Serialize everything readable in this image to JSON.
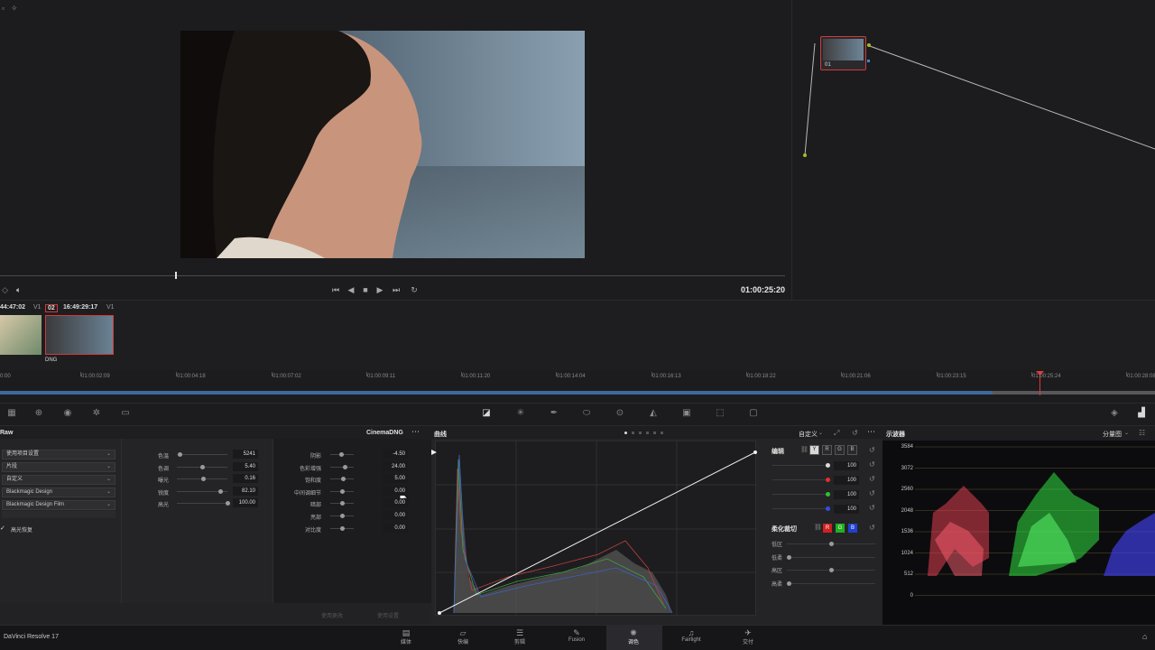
{
  "viewer": {
    "timecode": "01:00:25:20"
  },
  "nodes": {
    "node_label": "01"
  },
  "clips": {
    "clip1_tc": "44:47:02",
    "clip1_track": "V1",
    "clip2_num": "02",
    "clip2_tc": "16:49:29:17",
    "clip2_track": "V1",
    "clip2_name": "DNG"
  },
  "ruler": {
    "ticks": [
      "0:00",
      "01:00:02:09",
      "01:00:04:18",
      "01:00:07:02",
      "01:00:09:11",
      "01:00:11:20",
      "01:00:14:04",
      "01:00:16:13",
      "01:00:18:22",
      "01:00:21:06",
      "01:00:23:15",
      "01:00:25:24",
      "01:00:28:08"
    ]
  },
  "raw": {
    "title": "Raw",
    "codec": "CinemaDNG",
    "selects": [
      "使用项目设置",
      "片段",
      "自定义",
      "Blackmagic Design",
      "Blackmagic Design Film"
    ],
    "checkbox_label": "高光恢复",
    "col1": [
      {
        "label": "色温",
        "value": "5241",
        "pos": 0.05
      },
      {
        "label": "色调",
        "value": "5.40",
        "pos": 0.5
      },
      {
        "label": "曝光",
        "value": "0.16",
        "pos": 0.52
      },
      {
        "label": "锐度",
        "value": "82.10",
        "pos": 0.85
      },
      {
        "label": "高光",
        "value": "100.00",
        "pos": 1.0
      }
    ],
    "col2": [
      {
        "label": "阴影",
        "value": "-4.50",
        "pos": 0.48
      },
      {
        "label": "色彩增强",
        "value": "24.00",
        "pos": 0.6
      },
      {
        "label": "饱和度",
        "value": "5.00",
        "pos": 0.52
      },
      {
        "label": "中间调细节",
        "value": "0.00",
        "pos": 0.5
      },
      {
        "label": "暗部",
        "value": "0.00",
        "pos": 0.5
      },
      {
        "label": "亮部",
        "value": "0.00",
        "pos": 0.5
      },
      {
        "label": "对比度",
        "value": "0.00",
        "pos": 0.5
      }
    ],
    "btn_use": "使用更改",
    "btn_apply": "使用设置"
  },
  "curves": {
    "title": "曲线",
    "mode": "自定义"
  },
  "edit": {
    "title": "编辑",
    "channels": [
      "Y",
      "R",
      "G",
      "B"
    ],
    "values": [
      "100",
      "100",
      "100",
      "100"
    ],
    "dot_colors": [
      "#dddddd",
      "#e03030",
      "#30c030",
      "#3050e0"
    ],
    "soft_title": "柔化裁切",
    "soft_rows": [
      "低区",
      "低柔",
      "高区",
      "高柔"
    ]
  },
  "scope": {
    "title": "示波器",
    "mode": "分量图",
    "ylabels": [
      "3584",
      "3072",
      "2560",
      "2048",
      "1536",
      "1024",
      "512",
      "0"
    ]
  },
  "bottom": {
    "app": "DaVinci Resolve 17",
    "pages": [
      {
        "label": "媒体",
        "icon": "▤"
      },
      {
        "label": "快编",
        "icon": "▱"
      },
      {
        "label": "剪辑",
        "icon": "☰"
      },
      {
        "label": "Fusion",
        "icon": "✎"
      },
      {
        "label": "调色",
        "icon": "✺"
      },
      {
        "label": "Fairlight",
        "icon": "♫"
      },
      {
        "label": "交付",
        "icon": "✈"
      }
    ]
  }
}
